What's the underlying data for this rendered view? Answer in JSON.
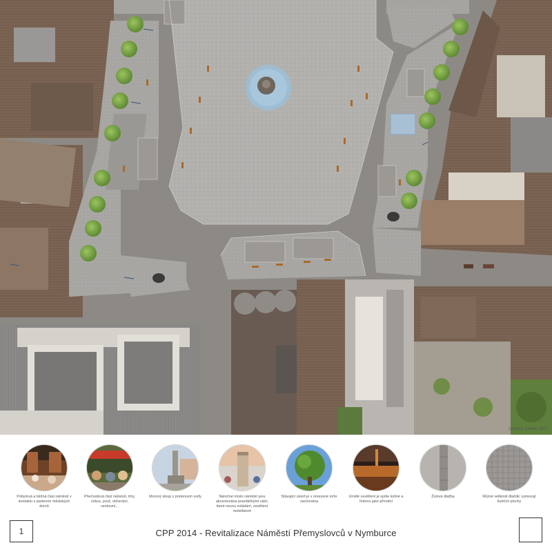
{
  "map": {
    "credit": "Letecký snímek 2007"
  },
  "legend": [
    {
      "id": "cafe",
      "caption": "Pobytová a běžná část náměstí v kontaktu s parterem městských domů"
    },
    {
      "id": "market",
      "caption": "Přechodová část náměstí, trhy, cirkus, pouť, občerství, venkovní..."
    },
    {
      "id": "column",
      "caption": "Morový sloup s prstencem vody"
    },
    {
      "id": "kiosk",
      "caption": "Náročné místo náměstí jsou akcentována pravidelnými válci, které nesou ovládání, osvětlení mobiliárem"
    },
    {
      "id": "tree",
      "caption": "Stávající zeleň je v omezené míře zachována"
    },
    {
      "id": "night",
      "caption": "Umělé osvětlení je spíše kolmé a řešeno jako přírodní"
    },
    {
      "id": "paving-strip",
      "caption": "Žulová dlažba"
    },
    {
      "id": "paving-cobble",
      "caption": "Různé velikosti dlaždic vymezují funkční plochy"
    }
  ],
  "footer": {
    "page_number": "1",
    "title": "CPP 2014 - Revitalizace Náměstí Přemyslovců v Nymburce"
  },
  "colors": {
    "road": "#8d8a86",
    "plaza": "#b6b4b1",
    "sidewalk": "#a8a6a3",
    "tree": "#7ba34a",
    "water": "#a9c7dc",
    "bench": "#a86a2c",
    "roof_brown": "#7a6352",
    "roof_grey": "#8d8c8a",
    "roof_light": "#c9c2b6"
  }
}
